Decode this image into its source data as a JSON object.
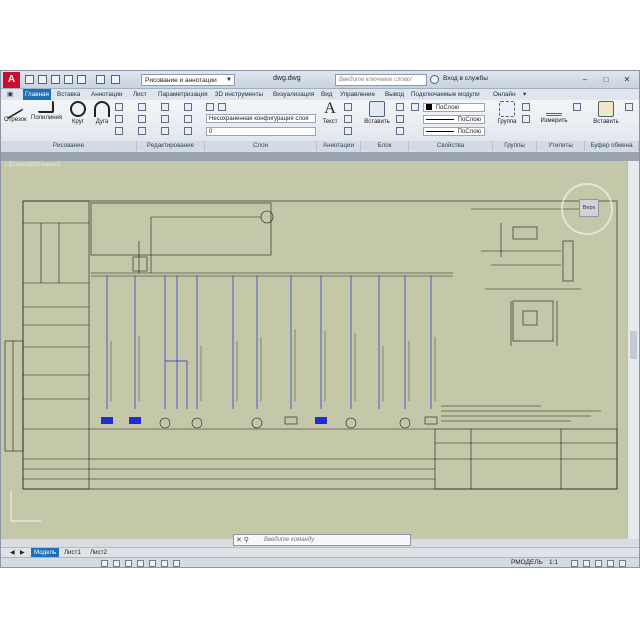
{
  "app": {
    "logo_letter": "A",
    "workspace": "Рисование и аннотации",
    "document_title": "dwg.dwg",
    "search_placeholder": "Введите ключевое слово/фразу",
    "signin": "Вход в службы"
  },
  "ribbon_tabs": [
    "Главная",
    "Вставка",
    "Аннотации",
    "Лист",
    "Параметризация",
    "3D инструменты",
    "Визуализация",
    "Вид",
    "Управление",
    "Вывод",
    "Подключаемые модули",
    "Онлайн"
  ],
  "active_tab": "Главная",
  "ribbon": {
    "draw_tools": [
      "Отрезок",
      "Полилиния",
      "Круг",
      "Дуга"
    ],
    "text_tool": "Текст",
    "insert_tool": "Вставить",
    "group_tool": "Группа",
    "measure_tool": "Измерить",
    "paste_tool": "Вставить",
    "layer_combo": "Несохраненная конфигурация слоя",
    "layer_value": "0",
    "color_combo": "ПоСлою",
    "linetype_combo": "ПоСлою",
    "lineweight_combo": "ПоСлою",
    "panels": [
      "Рисование",
      "Редактирование",
      "Слои",
      "Аннотации",
      "Блок",
      "Свойства",
      "Группы",
      "Утилиты",
      "Буфер обмена"
    ]
  },
  "viewport_label": "[-][Сверху][2D-каркас]",
  "viewcube_face": "Верх",
  "command_placeholder": "Введите команду",
  "layout_tabs": [
    "Модель",
    "Лист1",
    "Лист2"
  ],
  "active_layout": "Модель",
  "status": {
    "model": "РМОДЕЛЬ",
    "scale": "1:1"
  },
  "colors": {
    "accent": "#1f6fb7",
    "brand": "#c8102e",
    "canvas": "#c4c8a8",
    "wire": "#1e2bd6"
  }
}
